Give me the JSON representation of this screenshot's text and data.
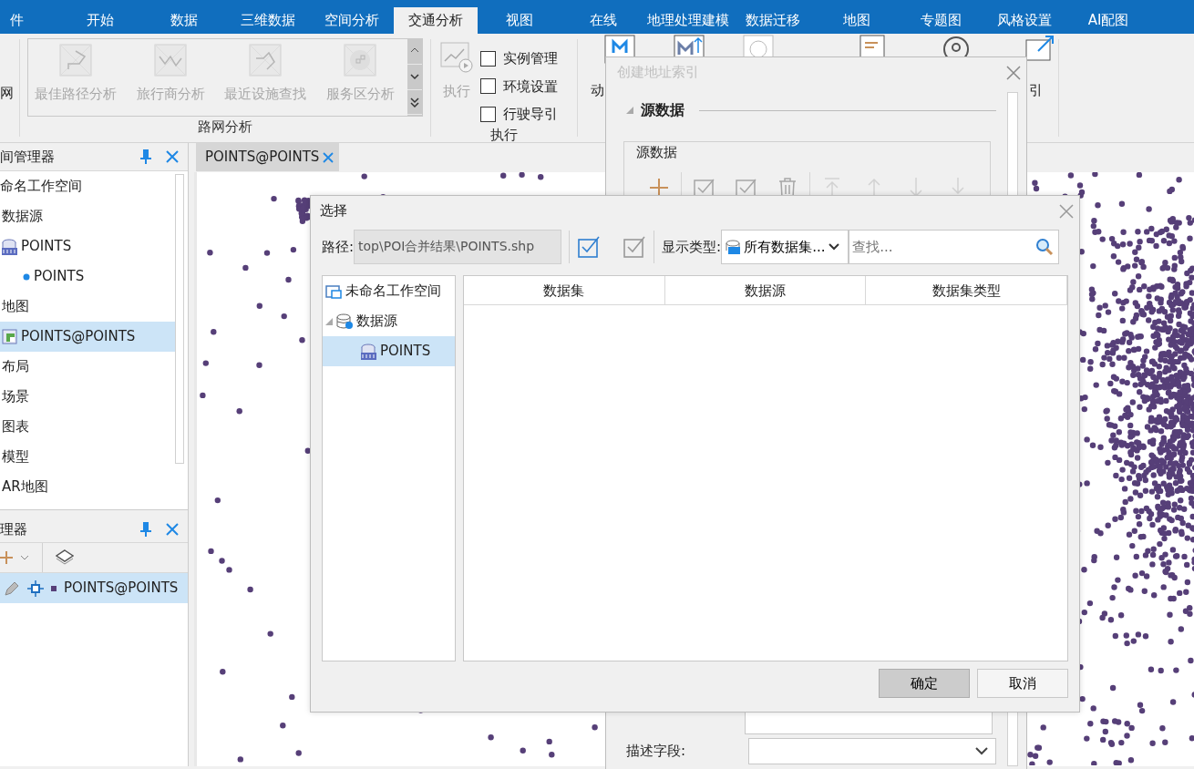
{
  "menu_tabs": [
    {
      "label": "件",
      "selected": false
    },
    {
      "label": "开始",
      "selected": false
    },
    {
      "label": "数据",
      "selected": false
    },
    {
      "label": "三维数据",
      "selected": false
    },
    {
      "label": "空间分析",
      "selected": false
    },
    {
      "label": "交通分析",
      "selected": true
    },
    {
      "label": "视图",
      "selected": false
    },
    {
      "label": "在线",
      "selected": false
    },
    {
      "label": "地理处理建模",
      "selected": false
    },
    {
      "label": "数据迁移",
      "selected": false
    },
    {
      "label": "地图",
      "selected": false
    },
    {
      "label": "专题图",
      "selected": false
    },
    {
      "label": "风格设置",
      "selected": false
    },
    {
      "label": "AI配图",
      "selected": false
    }
  ],
  "ribbon": {
    "left_partial_label": "网",
    "network_group": {
      "label": "路网分析",
      "items": [
        {
          "label": "最佳路径分析",
          "disabled": true
        },
        {
          "label": "旅行商分析",
          "disabled": true
        },
        {
          "label": "最近设施查找",
          "disabled": true
        },
        {
          "label": "服务区分析",
          "disabled": true
        }
      ]
    },
    "execute_group": {
      "label": "执行",
      "button": {
        "label": "执行",
        "disabled": true
      },
      "checkboxes": [
        {
          "label": "实例管理",
          "checked": false
        },
        {
          "label": "环境设置",
          "checked": false
        },
        {
          "label": "行驶导引",
          "checked": false
        }
      ]
    },
    "partial_labels": [
      "动",
      "引"
    ]
  },
  "workspace_panel": {
    "title": "间管理器",
    "tree": [
      {
        "label": "命名工作空间",
        "selected": false,
        "children": [
          {
            "label": "数据源",
            "selected": false,
            "children": [
              {
                "label": "POINTS",
                "kind": "datasource",
                "selected": false,
                "children": [
                  {
                    "label": "POINTS",
                    "kind": "point-dataset",
                    "selected": false
                  }
                ]
              }
            ]
          },
          {
            "label": "地图",
            "selected": false,
            "children": [
              {
                "label": "POINTS@POINTS",
                "kind": "map",
                "selected": true
              }
            ]
          },
          {
            "label": "布局",
            "selected": false
          },
          {
            "label": "场景",
            "selected": false
          },
          {
            "label": "图表",
            "selected": false
          },
          {
            "label": "模型",
            "selected": false
          },
          {
            "label": "AR地图",
            "selected": false
          }
        ]
      }
    ]
  },
  "layer_panel": {
    "title": "理器",
    "layers": [
      {
        "label": "POINTS@POINTS",
        "selected": true
      }
    ]
  },
  "map_tab": {
    "label": "POINTS@POINTS",
    "selected": true
  },
  "address_dialog": {
    "title": "创建地址索引",
    "section": "源数据",
    "group_label": "源数据",
    "toolbar": [
      {
        "kind": "add",
        "disabled": false
      },
      {
        "kind": "check-all",
        "disabled": false
      },
      {
        "kind": "check-invert",
        "disabled": false
      },
      {
        "kind": "delete",
        "disabled": false
      },
      {
        "kind": "move-top",
        "disabled": true
      },
      {
        "kind": "move-up",
        "disabled": true
      },
      {
        "kind": "move-down",
        "disabled": true
      },
      {
        "kind": "move-bottom",
        "disabled": true
      }
    ],
    "fields": [
      {
        "label": "描述字段:",
        "kind": "dropdown"
      }
    ]
  },
  "select_dialog": {
    "title": "选择",
    "path_label": "路径:",
    "path_value": "top\\POI合并结果\\POINTS.shp",
    "type_label": "显示类型:",
    "type_value": "所有数据集...",
    "search": {
      "placeholder": "查找..."
    },
    "tree": [
      {
        "label": "未命名工作空间",
        "kind": "workspace",
        "selected": false,
        "children": [
          {
            "label": "数据源",
            "kind": "datasources",
            "selected": false,
            "children": [
              {
                "label": "POINTS",
                "kind": "datasource",
                "selected": true
              }
            ]
          }
        ]
      }
    ],
    "columns": [
      "数据集",
      "数据源",
      "数据集类型"
    ],
    "buttons": [
      {
        "label": "确定",
        "kind": "primary"
      },
      {
        "label": "取消",
        "kind": "normal"
      }
    ]
  }
}
